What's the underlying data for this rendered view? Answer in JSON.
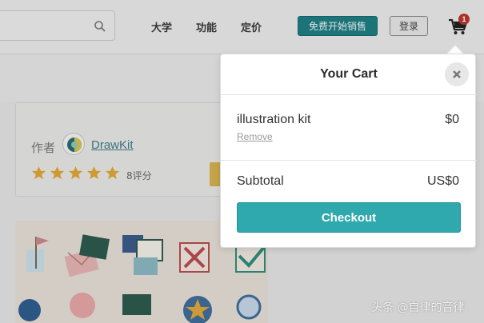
{
  "header": {
    "search": {
      "placeholder": "",
      "icon": "search-icon"
    },
    "nav": [
      {
        "label": "大学"
      },
      {
        "label": "功能"
      },
      {
        "label": "定价"
      }
    ],
    "sell_label": "免费开始销售",
    "login_label": "登录",
    "cart": {
      "icon": "cart-icon",
      "count": "1"
    }
  },
  "product": {
    "author_label": "作者",
    "author_name": "DrawKit",
    "rating_stars": 5,
    "rating_count": "8评分"
  },
  "cart_popup": {
    "title": "Your Cart",
    "close_icon": "close-icon",
    "items": [
      {
        "name": "illustration kit",
        "price": "$0",
        "remove_label": "Remove"
      }
    ],
    "subtotal_label": "Subtotal",
    "subtotal_value": "US$0",
    "checkout_label": "Checkout"
  },
  "watermark": "头条 @自律的音律",
  "colors": {
    "accent": "#2fa8ae",
    "sell_button": "#1f7e84",
    "badge": "#b9372f",
    "star": "#e0a83a",
    "link": "#3f7e86"
  }
}
